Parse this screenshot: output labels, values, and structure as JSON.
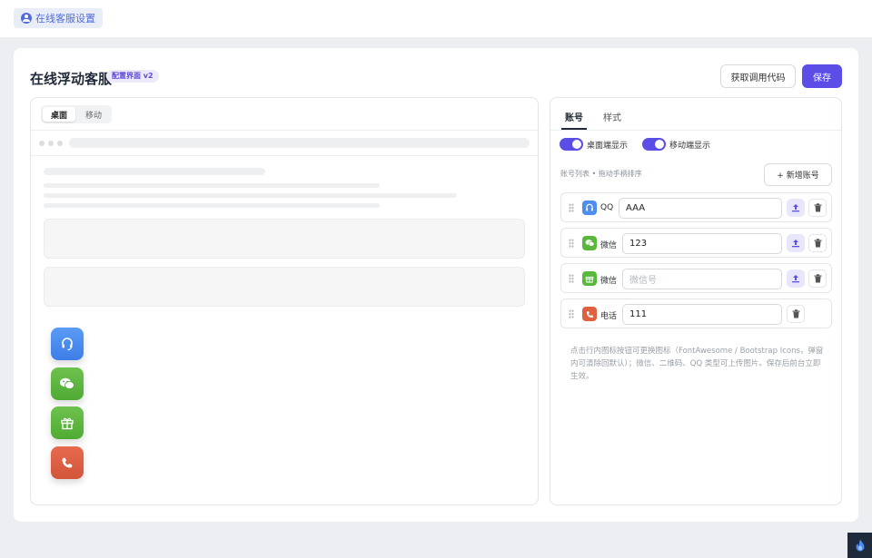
{
  "topbar": {
    "tab_label": "在线客服设置"
  },
  "header": {
    "title": "在线浮动客服",
    "badge": "配置界面 v2",
    "get_code_label": "获取调用代码",
    "save_label": "保存"
  },
  "preview": {
    "segments": [
      "桌面",
      "移动"
    ],
    "active_segment": "桌面",
    "float_buttons": [
      "qq",
      "wechat",
      "gift",
      "phone"
    ]
  },
  "settings": {
    "tabs": [
      "账号",
      "样式"
    ],
    "active_tab": "账号",
    "toggles": [
      {
        "label": "桌面端显示",
        "on": true
      },
      {
        "label": "移动端显示",
        "on": true
      }
    ],
    "list_caption": "账号列表 • 拖动手柄排序",
    "add_label": "+ 新增账号",
    "accounts": [
      {
        "type": "QQ",
        "icon": "headset-icon",
        "value": "AAA",
        "placeholder": "",
        "upload": true
      },
      {
        "type": "微信",
        "icon": "wechat-icon",
        "value": "123",
        "placeholder": "",
        "upload": true
      },
      {
        "type": "微信",
        "icon": "gift-icon",
        "value": "",
        "placeholder": "微信号",
        "upload": true
      },
      {
        "type": "电话",
        "icon": "phone-icon",
        "value": "111",
        "placeholder": "",
        "upload": false
      }
    ],
    "hint": "点击行内图标按钮可更换图标（FontAwesome / Bootstrap Icons，弹窗内可清除回默认）；微信、二维码、QQ 类型可上传图片。保存后前台立即生效。"
  },
  "colors": {
    "accent": "#5b4ee6",
    "qq": "#4f8ef0",
    "wechat": "#57b83c",
    "phone": "#e0603f"
  }
}
